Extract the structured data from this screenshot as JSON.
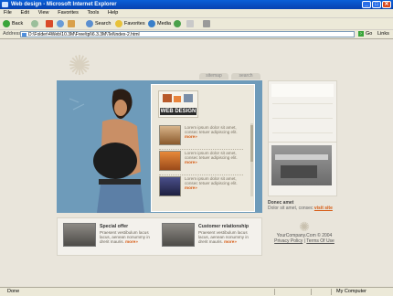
{
  "browser": {
    "title": "Web design - Microsoft Internet Explorer",
    "menu": [
      "File",
      "Edit",
      "View",
      "Favorites",
      "Tools",
      "Help"
    ],
    "toolbar": {
      "back": "Back",
      "search": "Search",
      "favorites": "Favorites",
      "media": "Media"
    },
    "address_label": "Address",
    "address_value": "D:\\Folder\\4Web\\10.3M\\Free\\tpl\\6.3.3M\\Tel\\index-2.html",
    "go_label": "Go",
    "links_label": "Links",
    "status_left": "Done",
    "status_zone": "My Computer"
  },
  "page": {
    "nav": [
      "sitemap",
      "search"
    ],
    "logo_caption": "WEB DESIGN",
    "news": [
      {
        "text": "Lorem ipsum dolor sit amet, consec tetuer adipiscing elit.",
        "more": "more»"
      },
      {
        "text": "Lorem ipsum dolor sit amet, consec tetuer adipiscing elit.",
        "more": "more»"
      },
      {
        "text": "Lorem ipsum dolor sit amet, consec tetuer adipiscing elit.",
        "more": "more»"
      }
    ],
    "promo": {
      "title": "Donec amet",
      "desc": "Dolor sit amet, consec",
      "link": "visit site"
    },
    "bottom": [
      {
        "title": "Special offer",
        "desc": "Praesent vestibulum lacus lacus, aenean nonummy in drerit mauris.",
        "more": "more»"
      },
      {
        "title": "Customer relationship",
        "desc": "Praesent vestibulum lacus lacus, aenean nonummy in drerit mauris.",
        "more": "more»"
      }
    ],
    "footer": {
      "copyright": "YourCompany.Com © 2004",
      "privacy": "Privacy Policy",
      "sep": "|",
      "terms": "Terms Of Use"
    }
  },
  "colors": {
    "accent": "#d65a12",
    "main_panel": "#6e9bba",
    "titlebar": "#0a5fd8"
  }
}
